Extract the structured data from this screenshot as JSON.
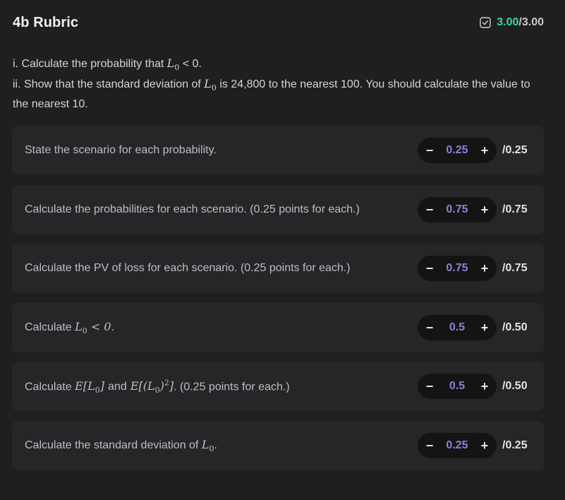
{
  "header": {
    "title": "4b Rubric",
    "score_earned": "3.00",
    "score_max": "/3.00"
  },
  "prompt": {
    "line1_a": "i. Calculate the probability that ",
    "line1_var": "L",
    "line1_sub": "0",
    "line1_b": " < 0.",
    "line2_a": "ii. Show that the standard deviation of ",
    "line2_var": "L",
    "line2_sub": "0",
    "line2_b": " is 24,800 to the nearest 100. You should calculate the value to the nearest 10."
  },
  "items": [
    {
      "text": "State the scenario for each probability.",
      "value": "0.25",
      "max": "/0.25"
    },
    {
      "text": "Calculate the probabilities for each scenario. (0.25 points for each.)",
      "value": "0.75",
      "max": "/0.75"
    },
    {
      "text": "Calculate the PV of loss for each scenario. (0.25 points for each.)",
      "value": "0.75",
      "max": "/0.75"
    },
    {
      "text_a": "Calculate ",
      "math": "L0 < 0",
      "text_b": ".",
      "value": "0.5",
      "max": "/0.50"
    },
    {
      "text_a": "Calculate ",
      "math": "E[L0] and E[(L0)^2]",
      "text_b": ". (0.25 points for each.)",
      "value": "0.5",
      "max": "/0.50"
    },
    {
      "text_a": "Calculate the standard deviation of ",
      "math": "L0",
      "text_b": ".",
      "value": "0.25",
      "max": "/0.25"
    }
  ],
  "stepper": {
    "minus": "−",
    "plus": "+"
  },
  "icons": {
    "score_icon": "checkbox-check-icon"
  },
  "colors": {
    "earned": "#3ed39a",
    "value": "#8c80d6"
  }
}
